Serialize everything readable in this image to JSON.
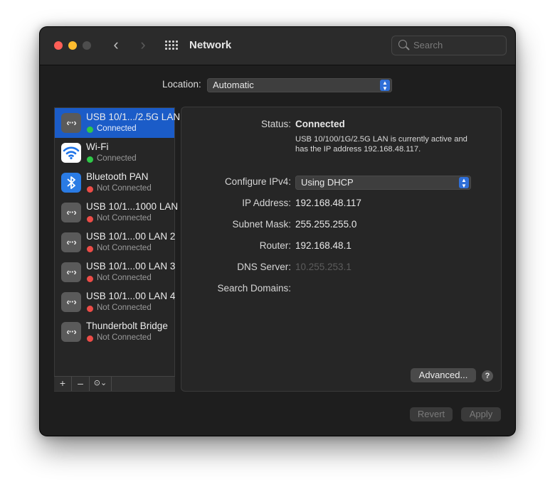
{
  "window": {
    "title": "Network",
    "search_placeholder": "Search",
    "nav_back": "‹",
    "nav_forward": "›"
  },
  "location": {
    "label": "Location:",
    "value": "Automatic"
  },
  "services": [
    {
      "name": "USB 10/1.../2.5G LAN",
      "status": "Connected",
      "status_color": "#2fc848",
      "icon": "ethernet-icon",
      "selected": true
    },
    {
      "name": "Wi-Fi",
      "status": "Connected",
      "status_color": "#2fc848",
      "icon": "wifi-icon"
    },
    {
      "name": "Bluetooth PAN",
      "status": "Not Connected",
      "status_color": "#ec4c47",
      "icon": "bluetooth-icon"
    },
    {
      "name": "USB 10/1...1000 LAN",
      "status": "Not Connected",
      "status_color": "#ec4c47",
      "icon": "ethernet-icon"
    },
    {
      "name": "USB 10/1...00 LAN 2",
      "status": "Not Connected",
      "status_color": "#ec4c47",
      "icon": "ethernet-icon"
    },
    {
      "name": "USB 10/1...00 LAN 3",
      "status": "Not Connected",
      "status_color": "#ec4c47",
      "icon": "ethernet-icon"
    },
    {
      "name": "USB 10/1...00 LAN 4",
      "status": "Not Connected",
      "status_color": "#ec4c47",
      "icon": "ethernet-icon"
    },
    {
      "name": "Thunderbolt Bridge",
      "status": "Not Connected",
      "status_color": "#ec4c47",
      "icon": "ethernet-icon"
    }
  ],
  "sidebar_toolbar": {
    "add": "+",
    "remove": "–",
    "action": "⊙⌄"
  },
  "detail": {
    "status_label": "Status:",
    "status_value": "Connected",
    "status_desc": "USB 10/100/1G/2.5G LAN is currently active and has the IP address 192.168.48.117.",
    "configure_label": "Configure IPv4:",
    "configure_value": "Using DHCP",
    "ip_label": "IP Address:",
    "ip_value": "192.168.48.117",
    "subnet_label": "Subnet Mask:",
    "subnet_value": "255.255.255.0",
    "router_label": "Router:",
    "router_value": "192.168.48.1",
    "dns_label": "DNS Server:",
    "dns_value": "10.255.253.1",
    "search_domains_label": "Search Domains:",
    "advanced_button": "Advanced...",
    "help_button": "?"
  },
  "footer": {
    "revert": "Revert",
    "apply": "Apply"
  },
  "colors": {
    "accent": "#1b5cc8",
    "connected": "#2fc848",
    "not_connected": "#ec4c47"
  }
}
